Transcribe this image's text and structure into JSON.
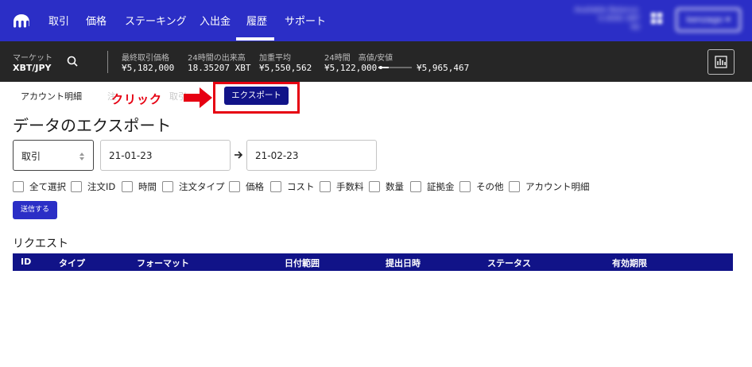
{
  "nav": {
    "items": [
      "取引",
      "価格",
      "ステーキング",
      "入出金",
      "履歴",
      "サポート"
    ],
    "active": "履歴",
    "balance_label": "Available Balance:",
    "balance_xbt": "0.0000 XBT",
    "balance_extra": "¥0",
    "user_label": "kenzago ▾"
  },
  "market": {
    "market_label": "マーケット",
    "pair": "XBT/JPY",
    "last_price_label": "最終取引価格",
    "last_price": "¥5,182,000",
    "volume_label": "24時間の出来高",
    "volume": "18.35207 XBT",
    "vwap_label": "加重平均",
    "vwap": "¥5,550,562",
    "range_label": "24時間　高値/安値",
    "low": "¥5,122,000",
    "high": "¥5,965,467",
    "range_position": 0.07
  },
  "subtabs": {
    "account_statement": "アカウント明細",
    "faded_left": "注",
    "faded_right": "取引",
    "export": "エクスポート"
  },
  "annotation": {
    "click": "クリック",
    "highlight_color": "#e60012"
  },
  "page": {
    "title": "データのエクスポート"
  },
  "filters": {
    "type_value": "取引",
    "date_from": "21-01-23",
    "date_to": "21-02-23"
  },
  "checkboxes": [
    "全て選択",
    "注文ID",
    "時間",
    "注文タイプ",
    "価格",
    "コスト",
    "手数料",
    "数量",
    "証拠金",
    "その他",
    "アカウント明細"
  ],
  "submit_label": "送信する",
  "requests": {
    "title": "リクエスト",
    "columns": [
      "ID",
      "タイプ",
      "フォーマット",
      "日付範囲",
      "提出日時",
      "ステータス",
      "有効期限"
    ]
  },
  "colors": {
    "brand": "#2b2ec6",
    "dark_brand": "#111388",
    "market_bg": "#262626"
  }
}
